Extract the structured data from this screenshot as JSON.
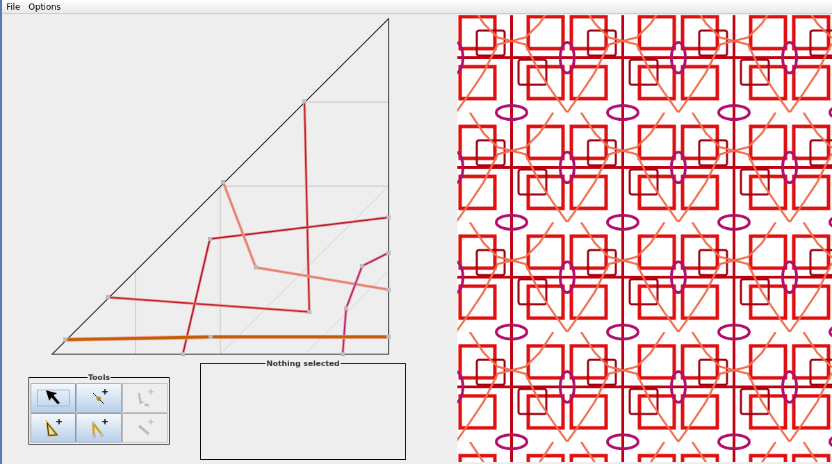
{
  "menu": [
    {
      "label": "File"
    },
    {
      "label": "Options"
    }
  ],
  "tools": {
    "title": "Tools",
    "buttons": [
      {
        "selected": true,
        "disabled": false
      },
      {
        "selected": false,
        "disabled": false
      },
      {
        "selected": false,
        "disabled": true
      },
      {
        "selected": false,
        "disabled": false
      },
      {
        "selected": false,
        "disabled": false
      },
      {
        "selected": false,
        "disabled": true
      }
    ]
  },
  "selection_panel": {
    "title": "Nothing selected"
  }
}
